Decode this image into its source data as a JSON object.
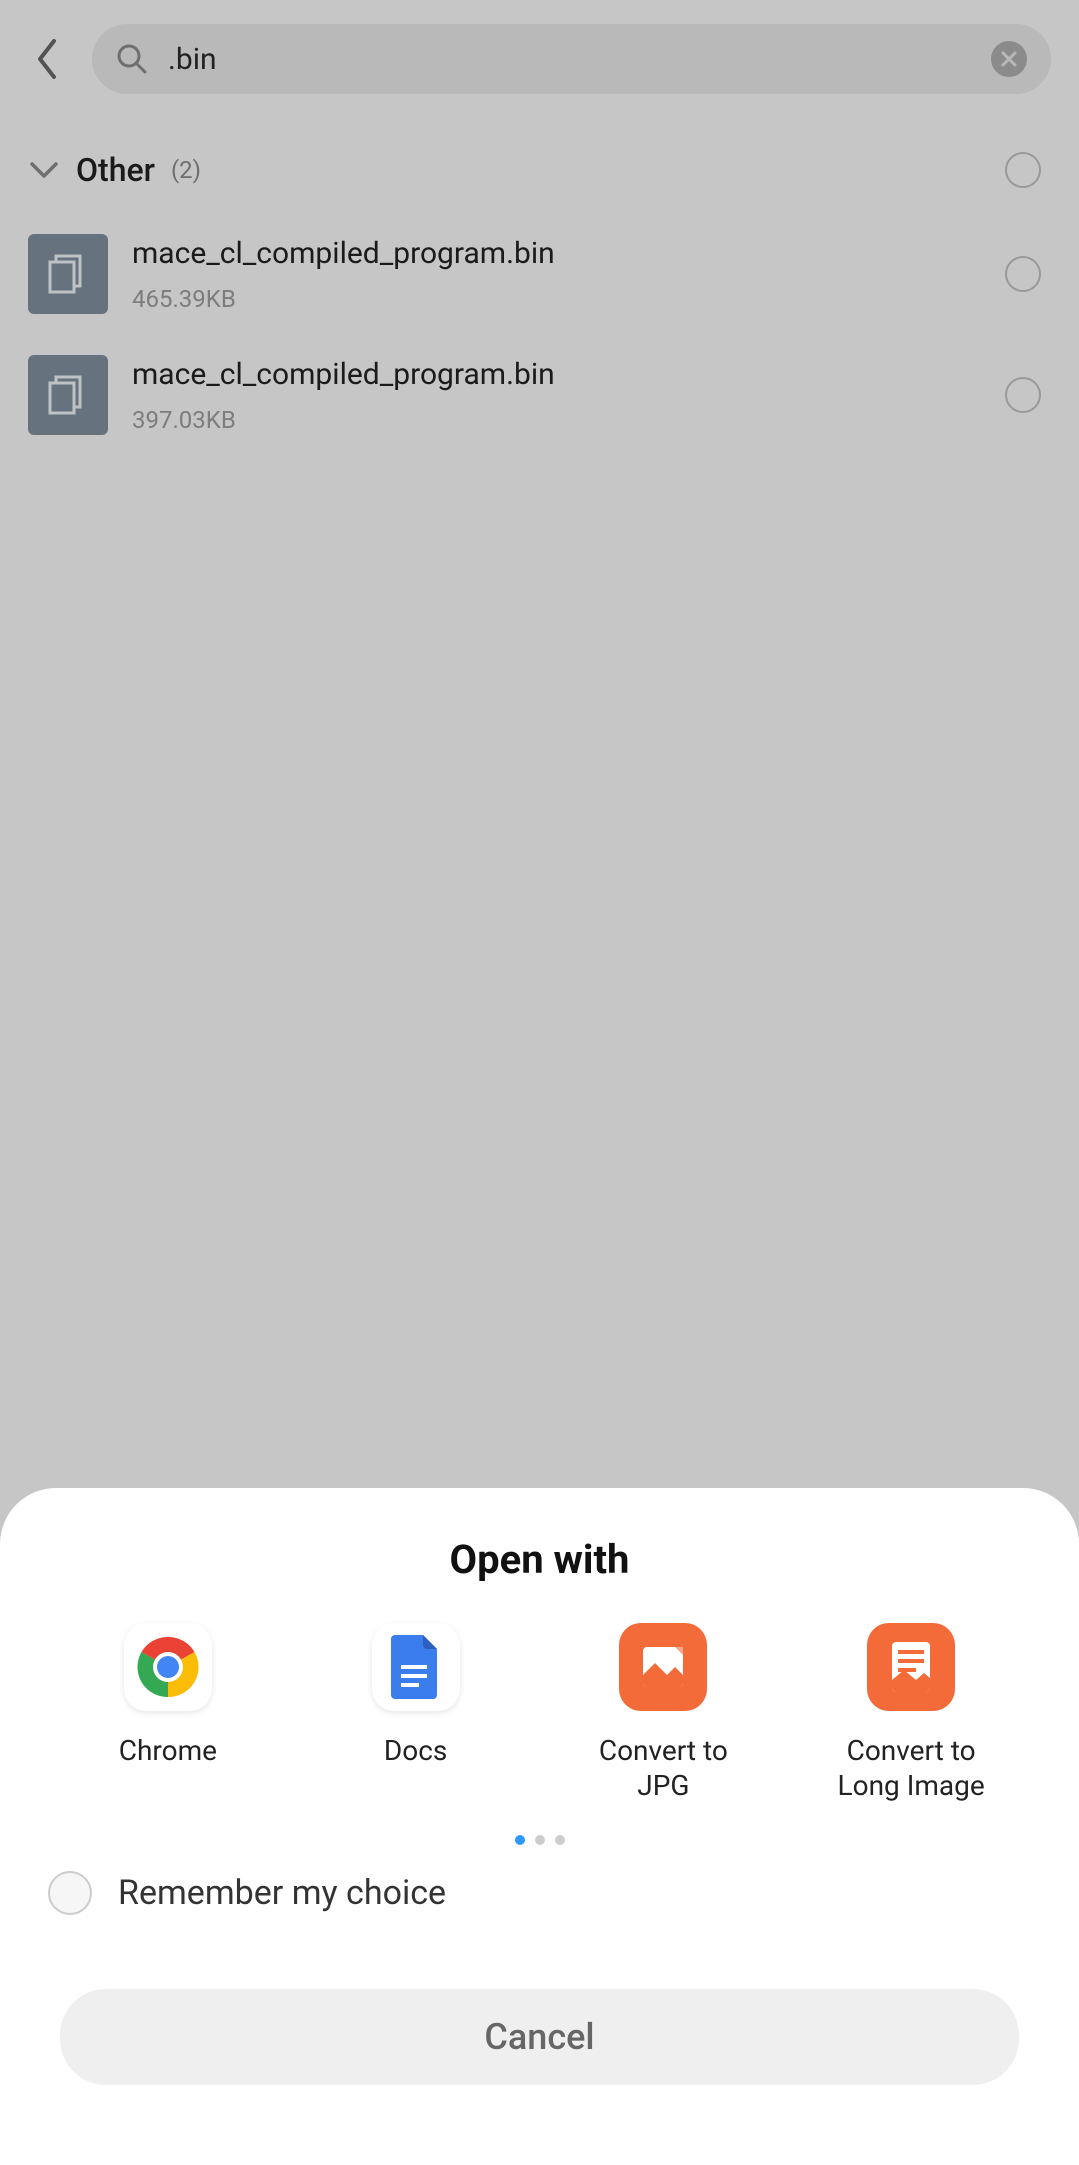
{
  "search": {
    "query": ".bin"
  },
  "group": {
    "label": "Other",
    "count": "(2)"
  },
  "files": [
    {
      "name": "mace_cl_compiled_program.bin",
      "size": "465.39KB"
    },
    {
      "name": "mace_cl_compiled_program.bin",
      "size": "397.03KB"
    }
  ],
  "sheet": {
    "title": "Open with",
    "apps": [
      {
        "label": "Chrome"
      },
      {
        "label": "Docs"
      },
      {
        "label": "Convert to JPG"
      },
      {
        "label": "Convert to Long Image"
      }
    ],
    "remember_label": "Remember my choice",
    "cancel_label": "Cancel"
  }
}
